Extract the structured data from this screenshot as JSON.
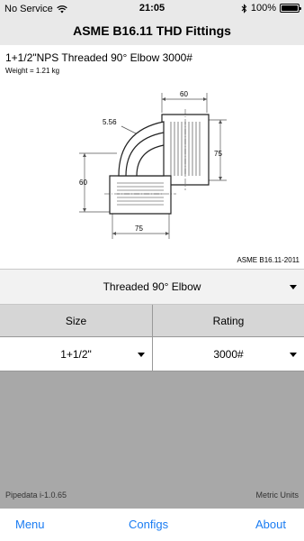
{
  "status": {
    "carrier": "No Service",
    "time": "21:05",
    "battery": "100%"
  },
  "header": {
    "title": "ASME B16.11 THD Fittings"
  },
  "fitting": {
    "title": "1+1/2\"NPS Threaded 90° Elbow 3000#",
    "weight": "Weight = 1.21 kg",
    "dims": {
      "top_width": "60",
      "wall": "5.56",
      "right_height": "75",
      "left_height": "60",
      "bottom_width": "75"
    },
    "standard": "ASME B16.11-2011"
  },
  "type_select": {
    "value": "Threaded 90° Elbow"
  },
  "table": {
    "headers": [
      "Size",
      "Rating"
    ],
    "values": [
      "1+1/2\"",
      "3000#"
    ]
  },
  "footer": {
    "version": "Pipedata i-1.0.65",
    "units": "Metric Units"
  },
  "tabs": [
    "Menu",
    "Configs",
    "About"
  ]
}
